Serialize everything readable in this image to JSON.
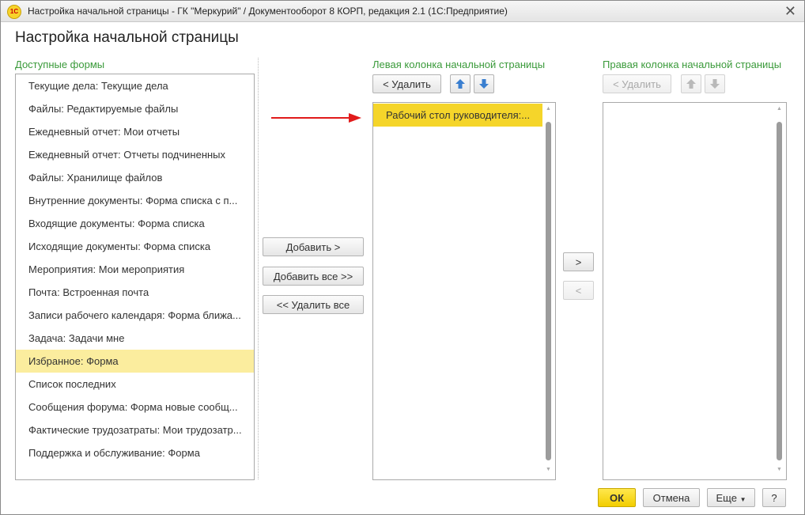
{
  "window": {
    "title": "Настройка начальной страницы - ГК \"Меркурий\" / Документооборот 8 КОРП, редакция 2.1  (1С:Предприятие)",
    "logo_text": "1С"
  },
  "page_title": "Настройка начальной страницы",
  "available": {
    "label": "Доступные формы",
    "items": [
      "Текущие дела: Текущие дела",
      "Файлы: Редактируемые файлы",
      "Ежедневный отчет: Мои отчеты",
      "Ежедневный отчет: Отчеты подчиненных",
      "Файлы: Хранилище файлов",
      "Внутренние документы: Форма списка с п...",
      "Входящие документы: Форма списка",
      "Исходящие документы: Форма списка",
      "Мероприятия: Мои мероприятия",
      "Почта: Встроенная почта",
      "Записи рабочего календаря: Форма ближа...",
      "Задача: Задачи мне",
      "Избранное: Форма",
      "Список последних",
      "Сообщения форума: Форма новые сообщ...",
      "Фактические трудозатраты: Мои трудозатр...",
      "Поддержка и обслуживание: Форма"
    ],
    "selected_index": 12
  },
  "middle_buttons": {
    "add": "Добавить >",
    "add_all": "Добавить все >>",
    "remove_all": "<< Удалить все"
  },
  "left_column": {
    "label": "Левая колонка начальной страницы",
    "remove": "< Удалить",
    "items": [
      "Рабочий стол руководителя:..."
    ]
  },
  "column_move": {
    "right": ">",
    "left": "<"
  },
  "right_column": {
    "label": "Правая колонка начальной страницы",
    "remove": "< Удалить",
    "items": []
  },
  "footer": {
    "ok": "ОК",
    "cancel": "Отмена",
    "more": "Еще",
    "help": "?"
  },
  "colors": {
    "accent_green": "#3a9a3a",
    "selected_yellow": "#f5d52a",
    "selected_light": "#fbed9e",
    "arrow_blue": "#3a7fd0",
    "annotation_red": "#e11b1b"
  }
}
